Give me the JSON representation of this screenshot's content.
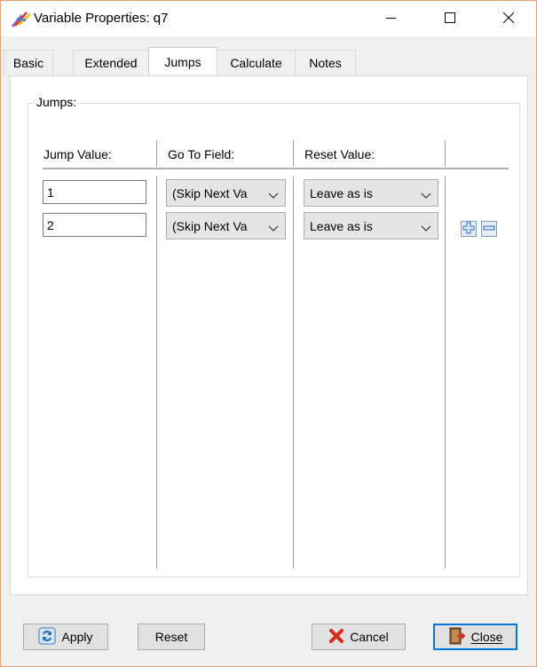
{
  "window": {
    "title": "Variable Properties: q7"
  },
  "tabs": [
    {
      "label": "Basic"
    },
    {
      "label": "Extended"
    },
    {
      "label": "Jumps"
    },
    {
      "label": "Calculate"
    },
    {
      "label": "Notes"
    }
  ],
  "active_tab": "Jumps",
  "jumps": {
    "group_label": "Jumps:",
    "columns": {
      "jump_value": "Jump Value:",
      "go_to_field": "Go To Field:",
      "reset_value": "Reset Value:"
    },
    "rows": [
      {
        "jump_value": "1",
        "go_to_field": "(Skip Next Va",
        "reset_value": "Leave as is"
      },
      {
        "jump_value": "2",
        "go_to_field": "(Skip Next Va",
        "reset_value": "Leave as is"
      }
    ]
  },
  "buttons": {
    "apply": "Apply",
    "reset": "Reset",
    "cancel": "Cancel",
    "close": "Close"
  },
  "icons": {
    "app": "app-icon",
    "minimize": "minimize-icon",
    "maximize": "maximize-icon",
    "close": "close-icon",
    "add": "plus-icon",
    "remove": "minus-icon",
    "apply": "refresh-icon",
    "cancel": "red-x-icon",
    "close_button": "door-exit-icon"
  },
  "colors": {
    "window_border": "#e8a07a",
    "default_button_border": "#0078d7",
    "cancel_x": "#d62a1c"
  }
}
